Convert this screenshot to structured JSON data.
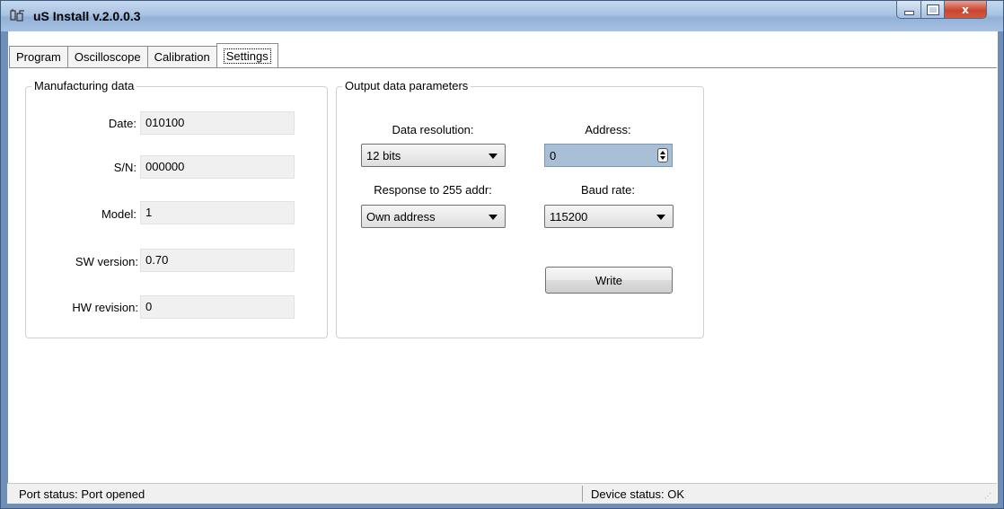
{
  "window": {
    "title": "uS Install v.2.0.0.3"
  },
  "tabs": [
    {
      "label": "Program"
    },
    {
      "label": "Oscilloscope"
    },
    {
      "label": "Calibration"
    },
    {
      "label": "Settings",
      "active": true
    }
  ],
  "manufacturing": {
    "legend": "Manufacturing data",
    "fields": [
      {
        "label": "Date:",
        "value": "010100"
      },
      {
        "label": "S/N:",
        "value": "000000"
      },
      {
        "label": "Model:",
        "value": "1"
      },
      {
        "label": "SW version:",
        "value": "0.70"
      },
      {
        "label": "HW revision:",
        "value": "0"
      }
    ]
  },
  "output": {
    "legend": "Output data parameters",
    "data_resolution_label": "Data resolution:",
    "data_resolution_value": "12 bits",
    "address_label": "Address:",
    "address_value": "0",
    "response_label": "Response to 255 addr:",
    "response_value": "Own address",
    "baud_label": "Baud rate:",
    "baud_value": "115200",
    "write_label": "Write"
  },
  "status": {
    "port": "Port status: Port opened",
    "device": "Device status: OK"
  },
  "colors": {
    "title_bar": "#a9c3e3",
    "close_button": "#c9452f",
    "spin_bg": "#a8bfd6"
  }
}
